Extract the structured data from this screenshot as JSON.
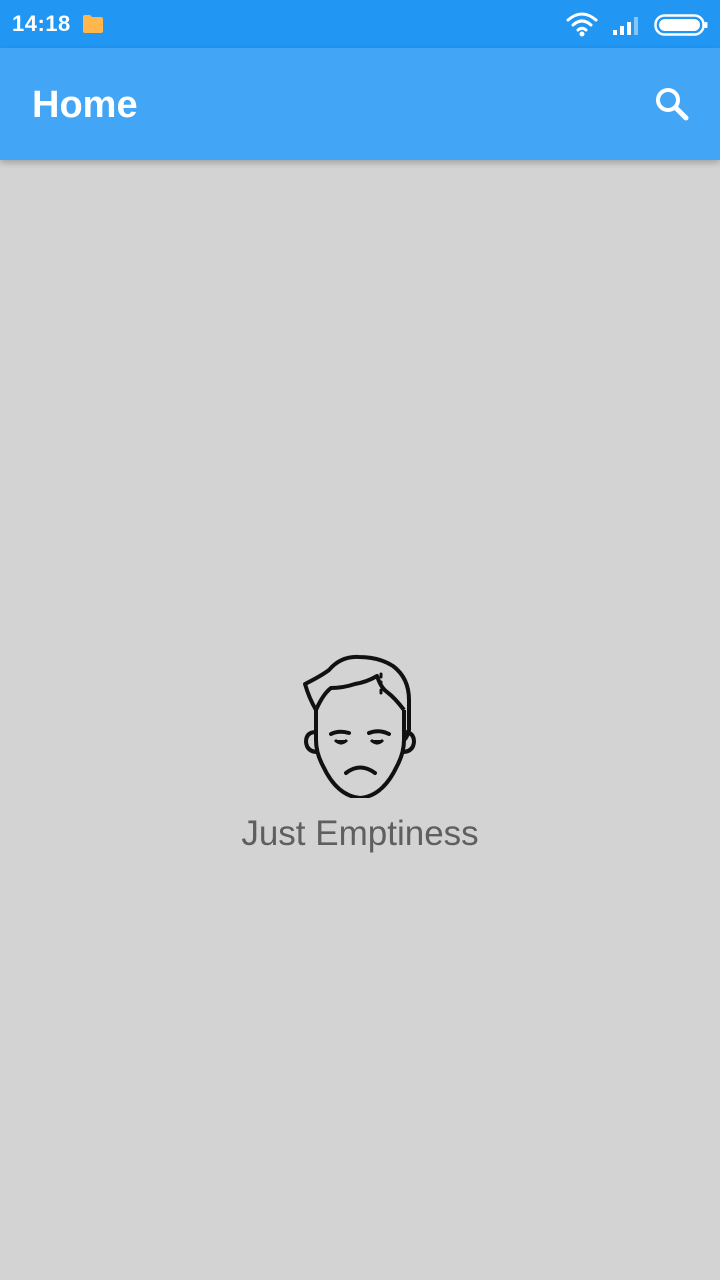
{
  "status_bar": {
    "time": "14:18",
    "icons": [
      "folder-icon",
      "wifi-icon",
      "signal-icon",
      "battery-icon"
    ],
    "color": "#2196f3"
  },
  "app_bar": {
    "title": "Home",
    "color": "#42a5f5",
    "action_icon": "search-icon"
  },
  "empty_state": {
    "icon": "sad-face-icon",
    "message": "Just Emptiness"
  },
  "colors": {
    "background": "#d3d3d3",
    "folder": "#ffb74d"
  }
}
